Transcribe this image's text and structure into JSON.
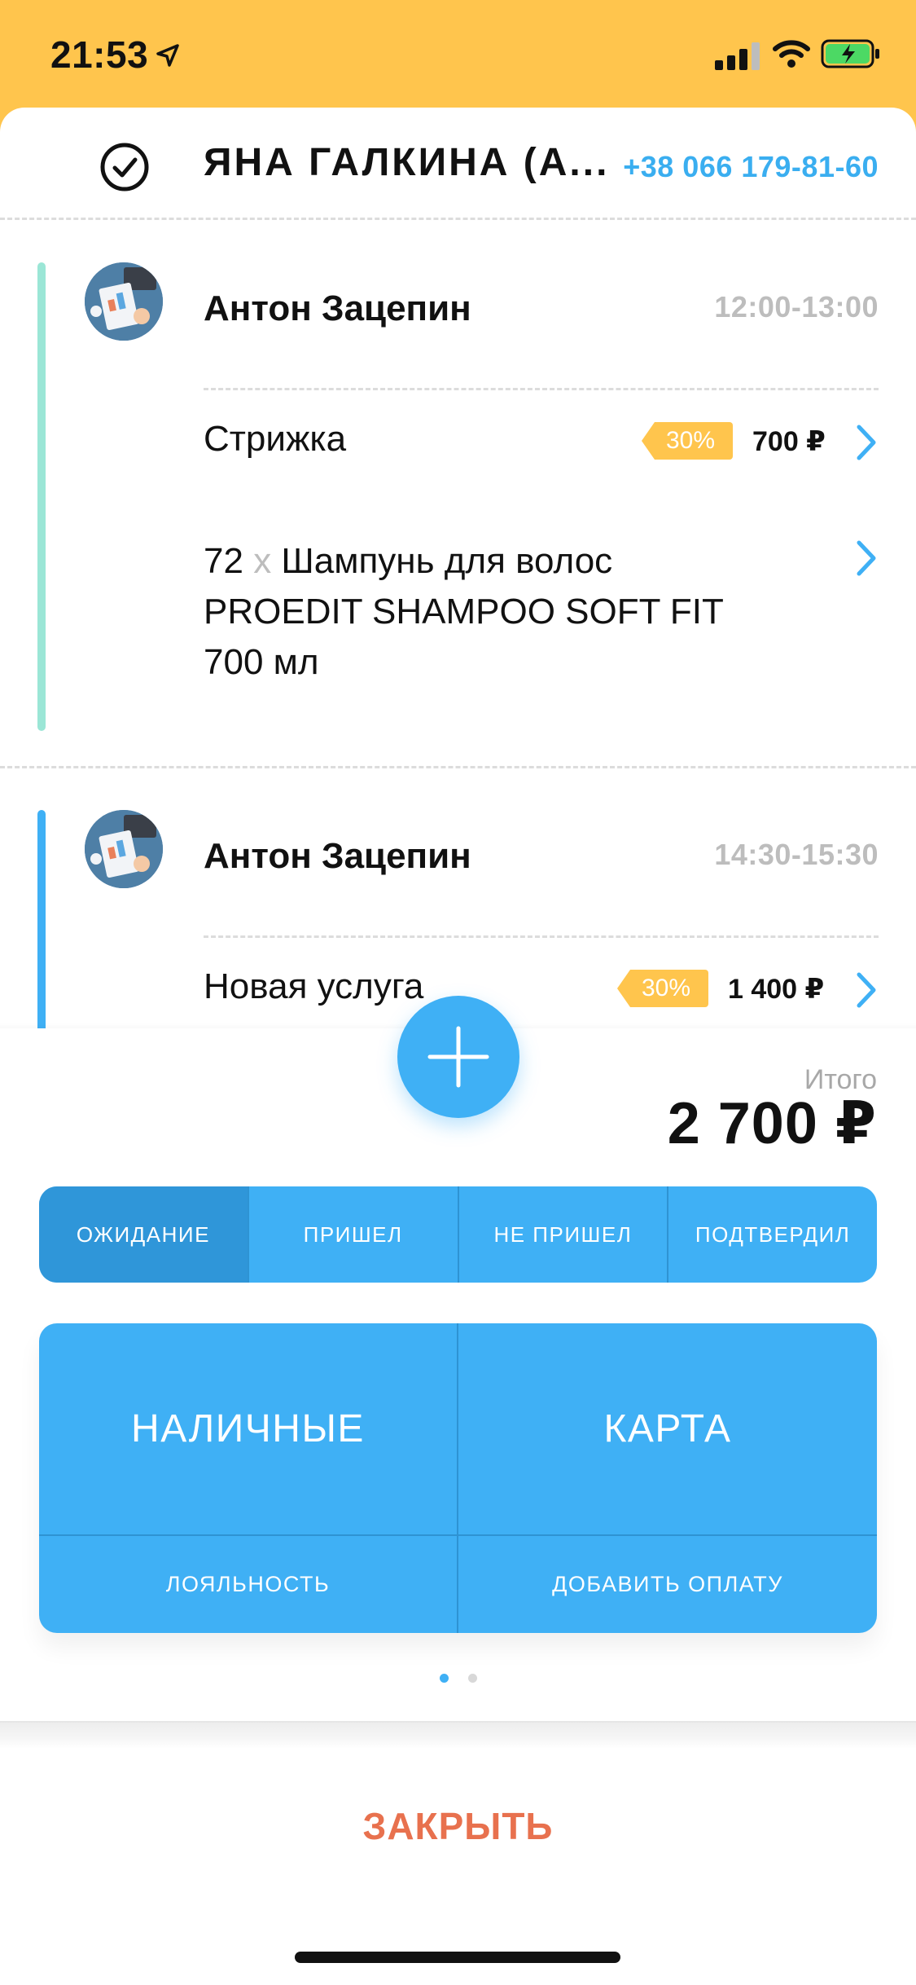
{
  "status_bar": {
    "time": "21:53"
  },
  "client": {
    "name": "ЯНА ГАЛКИНА (А...",
    "phone": "+38 066 179-81-60"
  },
  "visits": [
    {
      "master": "Антон Зацепин",
      "time": "12:00-13:00",
      "bar_color": "#9BE6D6",
      "service": {
        "name": "Стрижка",
        "discount": "30%",
        "price": "700 ₽"
      },
      "product": {
        "qty": "72",
        "x": "x",
        "line1": "Шампунь для волос",
        "line2": "PROEDIT SHAMPOO SOFT FIT",
        "line3": "700 мл"
      }
    },
    {
      "master": "Антон Зацепин",
      "time": "14:30-15:30",
      "bar_color": "#3FB0F5",
      "service": {
        "name": "Новая услуга",
        "discount": "30%",
        "price": "1 400 ₽"
      }
    }
  ],
  "total": {
    "label": "Итого",
    "value": "2 700 ₽"
  },
  "status_options": [
    "ОЖИДАНИЕ",
    "ПРИШЕЛ",
    "НЕ ПРИШЕЛ",
    "ПОДТВЕРДИЛ"
  ],
  "payment": {
    "cash": "НАЛИЧНЫЕ",
    "card": "КАРТА",
    "loyalty": "ЛОЯЛЬНОСТЬ",
    "add_payment": "ДОБАВИТЬ ОПЛАТУ"
  },
  "pager": {
    "pages": 2,
    "active": 1
  },
  "close_label": "ЗАКРЫТЬ",
  "colors": {
    "accent": "#3FB0F5",
    "header": "#FFC54D",
    "close": "#E8714E",
    "discount": "#FFC54D"
  }
}
